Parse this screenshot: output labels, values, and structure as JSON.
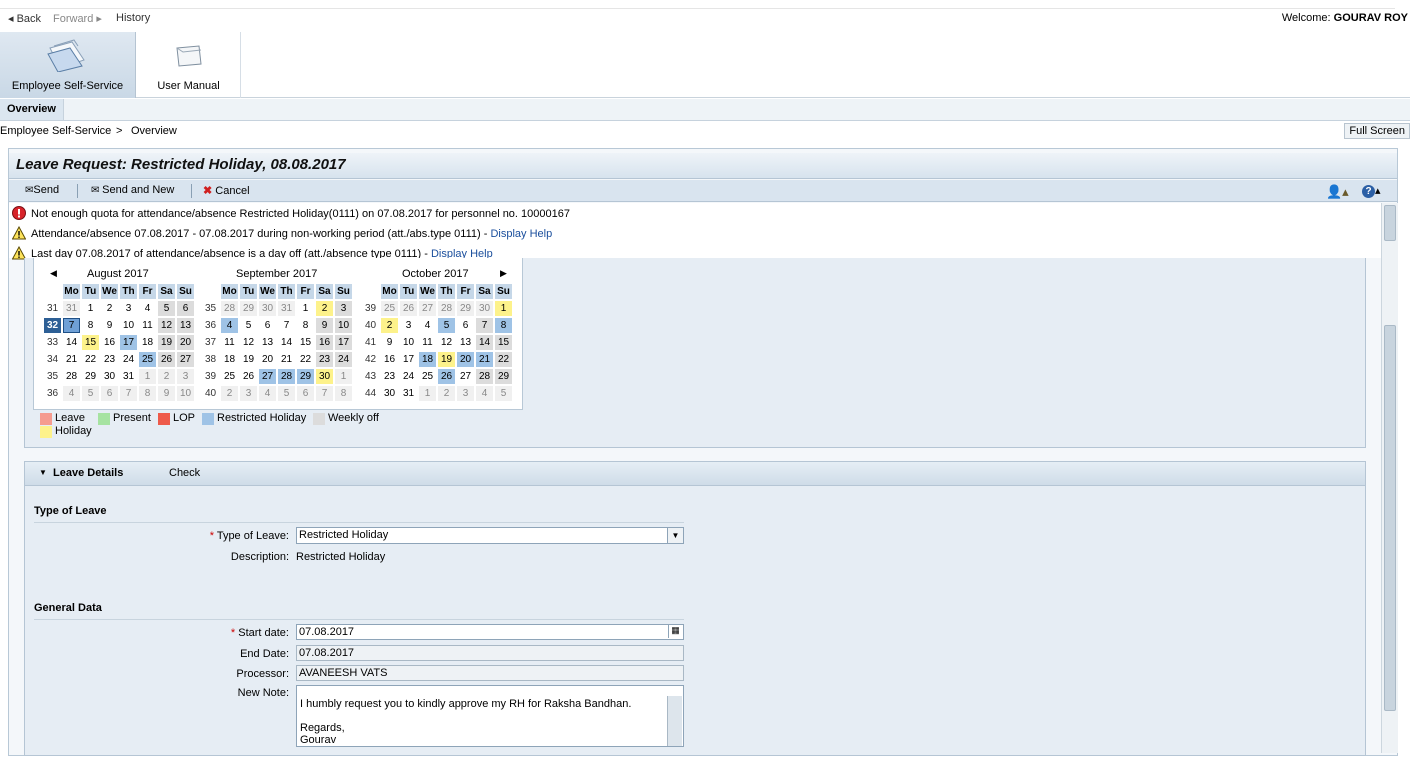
{
  "nav": {
    "back": "Back",
    "forward": "Forward",
    "history": "History",
    "welcome_prefix": "Welcome:",
    "user": "GOURAV ROY"
  },
  "tabs": [
    {
      "label": "Employee Self-Service",
      "icon": "ess-icon"
    },
    {
      "label": "User Manual",
      "icon": "manual-icon"
    }
  ],
  "subnav": {
    "overview": "Overview"
  },
  "breadcrumb": {
    "root": "Employee Self-Service",
    "sep": ">",
    "current": "Overview",
    "fullscreen": "Full Screen"
  },
  "page": {
    "title": "Leave Request: Restricted Holiday, 08.08.2017"
  },
  "toolbar": {
    "send": "Send",
    "send_new": "Send and New",
    "cancel": "Cancel"
  },
  "messages": [
    {
      "type": "error",
      "text": "Not enough quota  for attendance/absence Restricted Holiday(0111) on 07.08.2017 for personnel no. 10000167"
    },
    {
      "type": "warning",
      "text": "Attendance/absence 07.08.2017 - 07.08.2017 during non-working period (att./abs.type 0111) - ",
      "link": "Display Help"
    },
    {
      "type": "warning",
      "text": "Last day 07.08.2017 of attendance/absence is a day off (att./absence type 0111) - ",
      "link": "Display Help"
    }
  ],
  "calendar": {
    "weekdays": [
      "Mo",
      "Tu",
      "We",
      "Th",
      "Fr",
      "Sa",
      "Su"
    ],
    "months": [
      {
        "name": "August 2017",
        "weeks": [
          [
            "31",
            "31",
            "1",
            "2",
            "3",
            "4",
            "5",
            "6"
          ],
          [
            "32",
            "7",
            "8",
            "9",
            "10",
            "11",
            "12",
            "13"
          ],
          [
            "33",
            "14",
            "15",
            "16",
            "17",
            "18",
            "19",
            "20"
          ],
          [
            "34",
            "21",
            "22",
            "23",
            "24",
            "25",
            "26",
            "27"
          ],
          [
            "35",
            "28",
            "29",
            "30",
            "31",
            "1",
            "2",
            "3"
          ],
          [
            "36",
            "4",
            "5",
            "6",
            "7",
            "8",
            "9",
            "10"
          ]
        ]
      },
      {
        "name": "September 2017",
        "weeks": [
          [
            "35",
            "28",
            "29",
            "30",
            "31",
            "1",
            "2",
            "3"
          ],
          [
            "36",
            "4",
            "5",
            "6",
            "7",
            "8",
            "9",
            "10"
          ],
          [
            "37",
            "11",
            "12",
            "13",
            "14",
            "15",
            "16",
            "17"
          ],
          [
            "38",
            "18",
            "19",
            "20",
            "21",
            "22",
            "23",
            "24"
          ],
          [
            "39",
            "25",
            "26",
            "27",
            "28",
            "29",
            "30",
            "1"
          ],
          [
            "40",
            "2",
            "3",
            "4",
            "5",
            "6",
            "7",
            "8"
          ]
        ]
      },
      {
        "name": "October 2017",
        "weeks": [
          [
            "39",
            "25",
            "26",
            "27",
            "28",
            "29",
            "30",
            "1"
          ],
          [
            "40",
            "2",
            "3",
            "4",
            "5",
            "6",
            "7",
            "8"
          ],
          [
            "41",
            "9",
            "10",
            "11",
            "12",
            "13",
            "14",
            "15"
          ],
          [
            "42",
            "16",
            "17",
            "18",
            "19",
            "20",
            "21",
            "22"
          ],
          [
            "43",
            "23",
            "24",
            "25",
            "26",
            "27",
            "28",
            "29"
          ],
          [
            "44",
            "30",
            "31",
            "1",
            "2",
            "3",
            "4",
            "5"
          ]
        ]
      }
    ],
    "legend": [
      {
        "label": "Leave",
        "color": "#f59b8f"
      },
      {
        "label": "Present",
        "color": "#a6e3a1"
      },
      {
        "label": "LOP",
        "color": "#ee5a4a"
      },
      {
        "label": "Restricted Holiday",
        "color": "#9fc3e6"
      },
      {
        "label": "Weekly off",
        "color": "#dcdcdc"
      },
      {
        "label": "Holiday",
        "color": "#fdf28b"
      }
    ]
  },
  "details": {
    "header": "Leave Details",
    "check": "Check",
    "type_section": "Type of Leave",
    "type_label": "Type of Leave:",
    "type_value": "Restricted Holiday",
    "desc_label": "Description:",
    "desc_value": "Restricted Holiday",
    "general_section": "General Data",
    "start_label": "Start date:",
    "start_value": "07.08.2017",
    "end_label": "End Date:",
    "end_value": "07.08.2017",
    "processor_label": "Processor:",
    "processor_value": "AVANEESH VATS",
    "note_label": "New Note:",
    "note_value": "I humbly request you to kindly approve my RH for Raksha Bandhan.\n\nRegards,\nGourav"
  }
}
